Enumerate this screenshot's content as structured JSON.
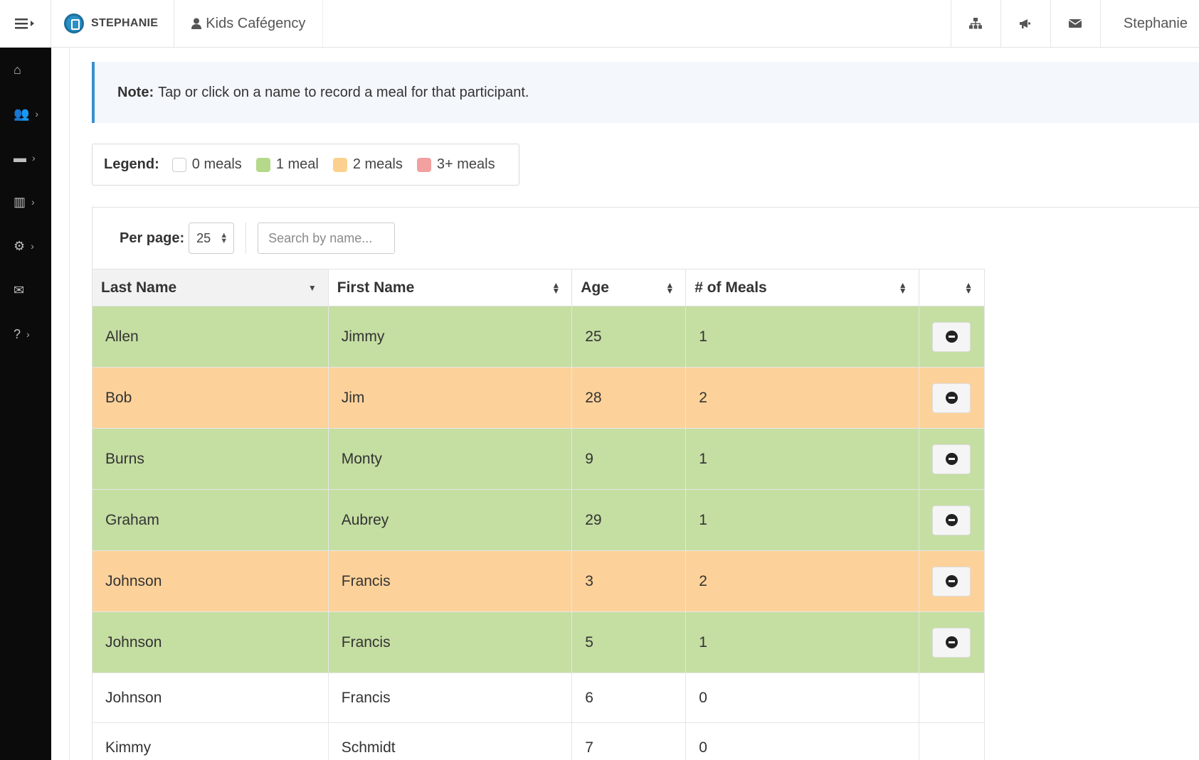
{
  "topbar": {
    "brand": "STEPHANIE",
    "org": "Kids Cafégency",
    "user": "Stephanie",
    "icons": [
      "sitemap-icon",
      "bullhorn-icon",
      "envelope-icon"
    ]
  },
  "sidebar": {
    "items": [
      {
        "icon": "home-icon",
        "glyph": "⌂",
        "chevron": false
      },
      {
        "icon": "users-icon",
        "glyph": "👥",
        "chevron": true
      },
      {
        "icon": "card-icon",
        "glyph": "▬",
        "chevron": true
      },
      {
        "icon": "bar-chart-icon",
        "glyph": "▥",
        "chevron": true
      },
      {
        "icon": "cogs-icon",
        "glyph": "⚙",
        "chevron": true
      },
      {
        "icon": "envelope-icon",
        "glyph": "✉",
        "chevron": false
      },
      {
        "icon": "help-icon",
        "glyph": "?",
        "chevron": true
      }
    ]
  },
  "note": {
    "label": "Note:",
    "text": "Tap or click on a name to record a meal for that participant."
  },
  "legend": {
    "title": "Legend:",
    "items": [
      {
        "label": "0 meals",
        "color": "#ffffff"
      },
      {
        "label": "1 meal",
        "color": "#b5d98a"
      },
      {
        "label": "2 meals",
        "color": "#fcd08e"
      },
      {
        "label": "3+ meals",
        "color": "#f2a0a0"
      }
    ]
  },
  "controls": {
    "per_page_label": "Per page:",
    "per_page_value": "25",
    "search_placeholder": "Search by name..."
  },
  "table": {
    "columns": [
      "Last Name",
      "First Name",
      "Age",
      "# of Meals",
      ""
    ],
    "rows": [
      {
        "last": "Allen",
        "first": "Jimmy",
        "age": "25",
        "meals": "1"
      },
      {
        "last": "Bob",
        "first": "Jim",
        "age": "28",
        "meals": "2"
      },
      {
        "last": "Burns",
        "first": "Monty",
        "age": "9",
        "meals": "1"
      },
      {
        "last": "Graham",
        "first": "Aubrey",
        "age": "29",
        "meals": "1"
      },
      {
        "last": "Johnson",
        "first": "Francis",
        "age": "3",
        "meals": "2"
      },
      {
        "last": "Johnson",
        "first": "Francis",
        "age": "5",
        "meals": "1"
      },
      {
        "last": "Johnson",
        "first": "Francis",
        "age": "6",
        "meals": "0"
      },
      {
        "last": "Kimmy",
        "first": "Schmidt",
        "age": "7",
        "meals": "0"
      }
    ]
  }
}
